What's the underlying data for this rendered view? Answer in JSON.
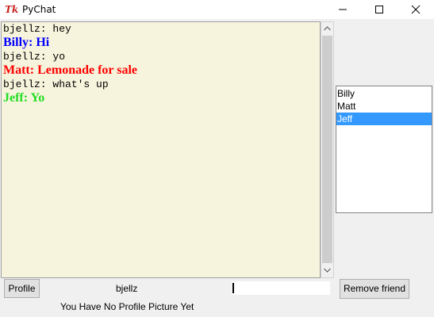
{
  "window": {
    "title": "PyChat",
    "icon": "tk-feather-icon"
  },
  "chat": {
    "messages": [
      {
        "sender": "bjellz",
        "text": "bjellz: hey",
        "style": "mono",
        "color": "#000000"
      },
      {
        "sender": "Billy",
        "text": "Billy: Hi",
        "style": "big",
        "color": "#0000ff"
      },
      {
        "sender": "bjellz",
        "text": "bjellz: yo",
        "style": "mono",
        "color": "#000000"
      },
      {
        "sender": "Matt",
        "text": "Matt: Lemonade for sale",
        "style": "big",
        "color": "#ff0000"
      },
      {
        "sender": "bjellz",
        "text": "bjellz: what's up",
        "style": "mono",
        "color": "#000000"
      },
      {
        "sender": "Jeff",
        "text": "Jeff: Yo",
        "style": "big",
        "color": "#22dd22"
      }
    ]
  },
  "friends": {
    "items": [
      "Billy",
      "Matt",
      "Jeff"
    ],
    "selected": "Jeff"
  },
  "bottom": {
    "profile_button": "Profile",
    "username": "bjellz",
    "message_input_value": "",
    "remove_friend_button": "Remove friend",
    "no_picture_text": "You Have No Profile Picture Yet"
  }
}
